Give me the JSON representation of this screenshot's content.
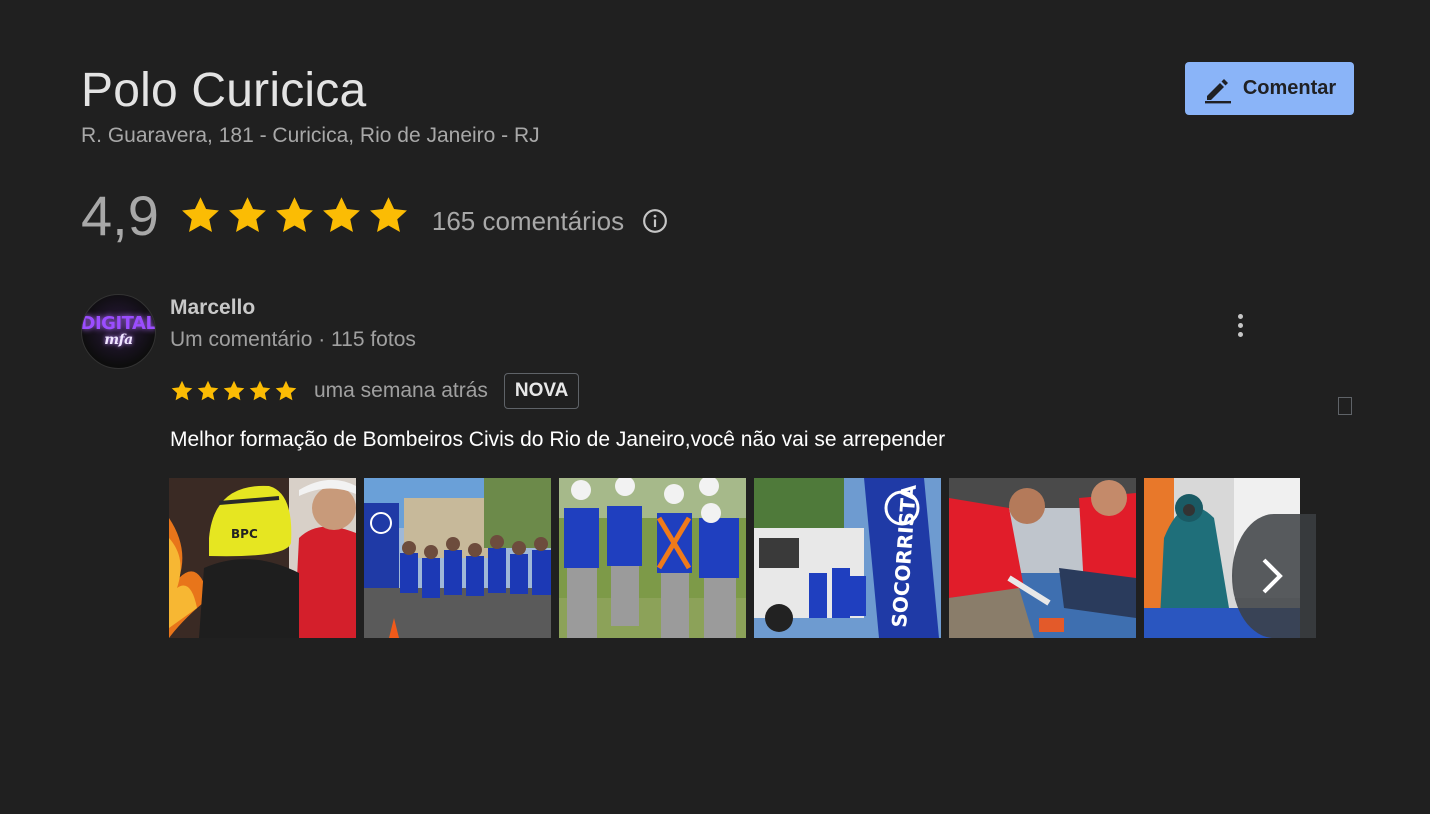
{
  "place": {
    "title": "Polo Curicica",
    "address": "R. Guaravera, 181 - Curicica, Rio de Janeiro - RJ"
  },
  "actions": {
    "comment_label": "Comentar",
    "comment_icon": "pencil-icon"
  },
  "rating": {
    "value": "4,9",
    "stars": 5,
    "reviews_label": "165 comentários",
    "star_color": "#fbbc04"
  },
  "review": {
    "author": "Marcello",
    "author_meta": "Um comentário · 115 fotos",
    "avatar_text_top": "DIGITAL",
    "avatar_text_bottom": "mfa",
    "stars": 5,
    "time": "uma semana atrás",
    "badge": "NOVA",
    "text": "Melhor formação de Bombeiros Civis do Rio de Janeiro,você não vai se arrepender",
    "photos": [
      {
        "name": "photo-helmet-fire-training",
        "helmet_text": "BPC"
      },
      {
        "name": "photo-group-blue-uniforms"
      },
      {
        "name": "photo-team-field-exercise"
      },
      {
        "name": "photo-ambulance-banner",
        "banner_text": "SOCORRISTA"
      },
      {
        "name": "photo-first-aid-practice"
      },
      {
        "name": "photo-hazmat-suit"
      }
    ]
  },
  "colors": {
    "background": "#202020",
    "accent": "#8ab4f8"
  }
}
